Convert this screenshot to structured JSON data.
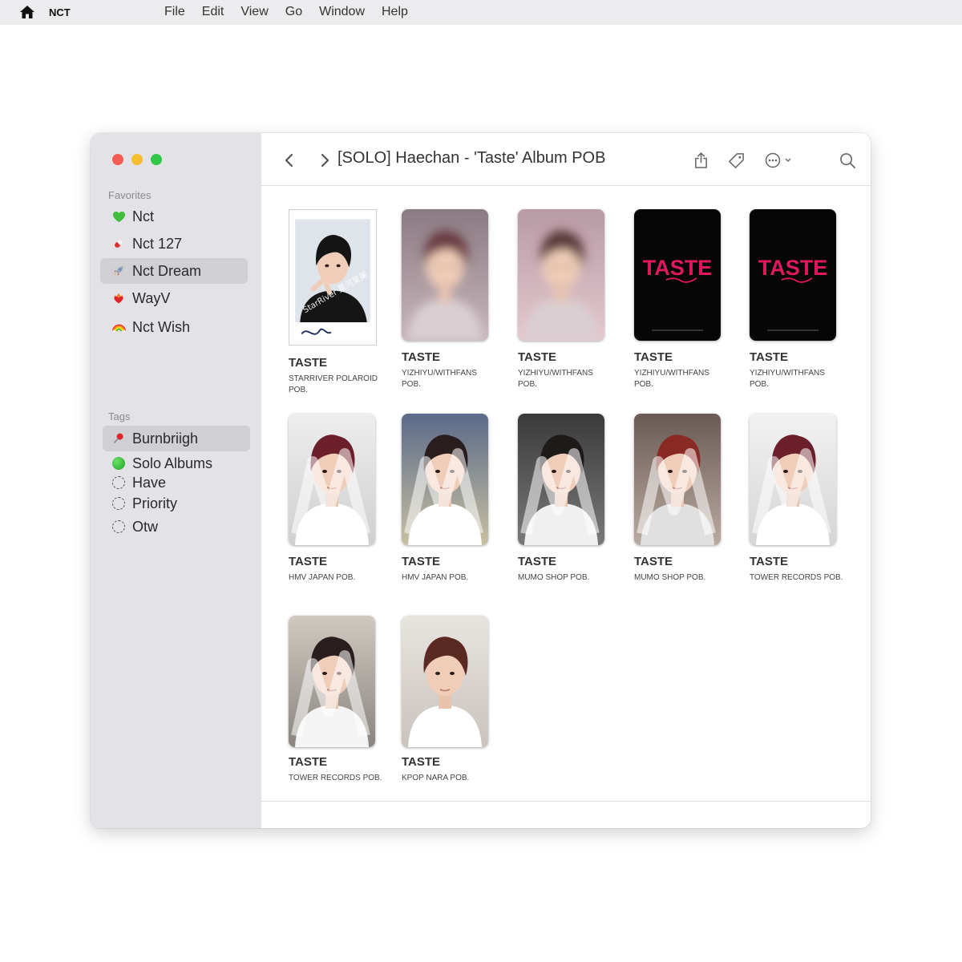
{
  "menubar": {
    "app_name": "NCT",
    "items": [
      "File",
      "Edit",
      "View",
      "Go",
      "Window",
      "Help"
    ]
  },
  "sidebar": {
    "favorites_label": "Favorites",
    "favorites": [
      {
        "label": "Nct",
        "icon": "green-heart-icon"
      },
      {
        "label": "Nct 127",
        "icon": "red-pill-icon"
      },
      {
        "label": "Nct Dream",
        "icon": "rocket-icon",
        "selected": true
      },
      {
        "label": "WayV",
        "icon": "heart-on-fire-icon"
      },
      {
        "label": "Nct Wish",
        "icon": "rainbow-icon"
      }
    ],
    "tags_label": "Tags",
    "tags": [
      {
        "label": "Burnbriigh",
        "icon": "pushpin-icon",
        "selected": true
      },
      {
        "label": "Solo Albums",
        "icon": "green-circle-icon"
      },
      {
        "label": "Have",
        "icon": "empty-circle-icon"
      },
      {
        "label": "Priority",
        "icon": "empty-circle-icon"
      },
      {
        "label": "Otw",
        "icon": "empty-circle-icon"
      }
    ]
  },
  "toolbar": {
    "title": "[SOLO] Haechan - 'Taste' Album POB"
  },
  "items": [
    {
      "title": "TASTE",
      "subtitle": "STARRIVER POLAROID POB.",
      "watermark": "StarRiver 星河星美"
    },
    {
      "title": "TASTE",
      "subtitle": "YIZHIYU/WITHFANS POB."
    },
    {
      "title": "TASTE",
      "subtitle": "YIZHIYU/WITHFANS POB."
    },
    {
      "title": "TASTE",
      "subtitle": "YIZHIYU/WITHFANS POB.",
      "card_text": "TASTE"
    },
    {
      "title": "TASTE",
      "subtitle": "YIZHIYU/WITHFANS POB.",
      "card_text": "TASTE"
    },
    {
      "title": "TASTE",
      "subtitle": "HMV JAPAN POB."
    },
    {
      "title": "TASTE",
      "subtitle": "HMV JAPAN POB."
    },
    {
      "title": "TASTE",
      "subtitle": "MUMO SHOP POB."
    },
    {
      "title": "TASTE",
      "subtitle": "MUMO SHOP POB."
    },
    {
      "title": "TASTE",
      "subtitle": "TOWER RECORDS POB."
    },
    {
      "title": "TASTE",
      "subtitle": "TOWER RECORDS POB."
    },
    {
      "title": "TASTE",
      "subtitle": "KPOP NARA POB."
    }
  ],
  "colors": {
    "sidebar_bg": "#e3e3e7",
    "selected_bg": "#cfcfd4",
    "taste_pink": "#e0185f"
  }
}
